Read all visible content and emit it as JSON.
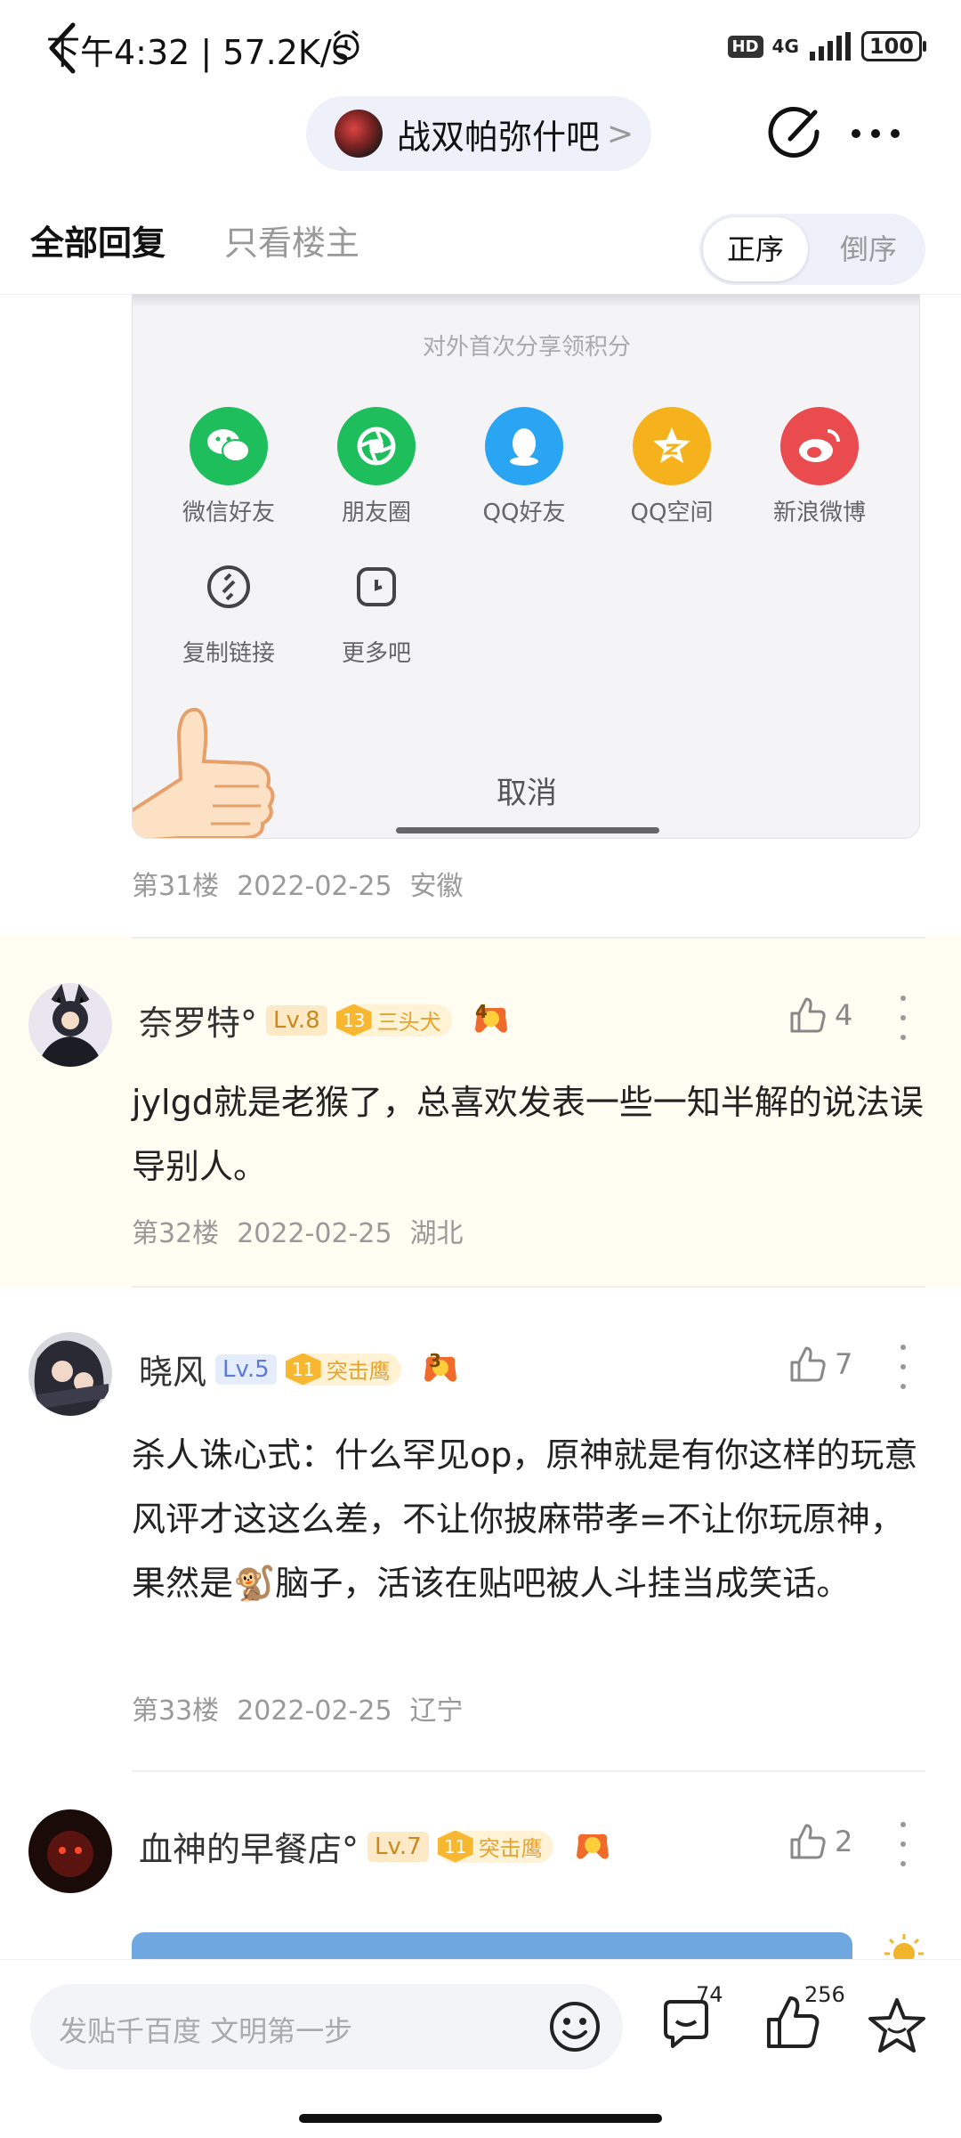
{
  "status_bar": {
    "time_and_speed": "下午4:32 | 57.2K/s",
    "hd": "HD",
    "network": "4G",
    "battery": "100"
  },
  "nav": {
    "forum_name": "战双帕弥什吧",
    "chevron": ">"
  },
  "tabs": {
    "all_replies": "全部回复",
    "owner_only": "只看楼主",
    "order_asc": "正序",
    "order_desc": "倒序"
  },
  "share_sheet": {
    "title": "对外首次分享领积分",
    "items": [
      {
        "label": "微信好友",
        "icon": "wechat-icon",
        "color": "#1fbe5c"
      },
      {
        "label": "朋友圈",
        "icon": "moments-icon",
        "color": "#1fbe5c"
      },
      {
        "label": "QQ好友",
        "icon": "qq-icon",
        "color": "#2aa5f3"
      },
      {
        "label": "QQ空间",
        "icon": "qzone-icon",
        "color": "#f6b21c"
      },
      {
        "label": "新浪微博",
        "icon": "weibo-icon",
        "color": "#ea4b4e"
      }
    ],
    "items2": [
      {
        "label": "复制链接",
        "icon": "link-icon"
      },
      {
        "label": "更多吧",
        "icon": "more-share-icon"
      }
    ],
    "cancel": "取消"
  },
  "post31_meta": {
    "floor": "第31楼",
    "date": "2022-02-25",
    "location": "安徽"
  },
  "posts": [
    {
      "username": "奈罗特°",
      "level": "Lv.8",
      "badge_num": "13",
      "badge_title": "三头犬",
      "game_level": "4",
      "likes": "4",
      "content": "jylgd就是老猴了，总喜欢发表一些一知半解的说法误导别人。",
      "floor": "第32楼",
      "date": "2022-02-25",
      "location": "湖北"
    },
    {
      "username": "晓风",
      "level": "Lv.5",
      "badge_num": "11",
      "badge_title": "突击鹰",
      "game_level": "3",
      "likes": "7",
      "content": "杀人诛心式：什么罕见op，原神就是有你这样的玩意风评才这这么差，不让你披麻带孝=不让你玩原神，果然是🐒脑子，活该在贴吧被人斗挂当成笑话。",
      "floor": "第33楼",
      "date": "2022-02-25",
      "location": "辽宁"
    },
    {
      "username": "血神的早餐店°",
      "level": "Lv.7",
      "badge_num": "11",
      "badge_title": "突击鹰",
      "likes": "2"
    }
  ],
  "bottom_bar": {
    "placeholder": "发贴千百度 文明第一步",
    "comment_count": "74",
    "like_count": "256"
  },
  "colors": {
    "highlight_bg": "#fffdf2",
    "accent_blue": "#5a7bd8",
    "badge_gold": "#f7b731"
  }
}
